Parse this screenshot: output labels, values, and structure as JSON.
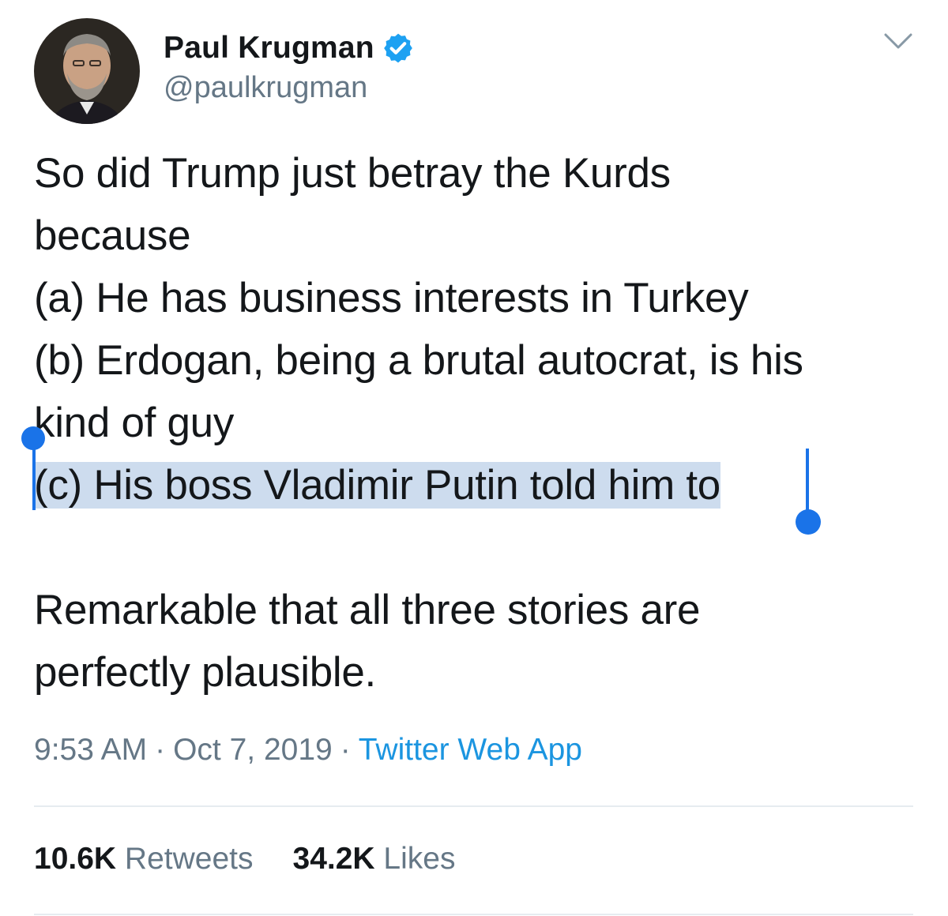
{
  "tweet": {
    "author": {
      "display_name": "Paul Krugman",
      "handle": "@paulkrugman",
      "verified_icon": "verified-badge-icon",
      "avatar_icon": "avatar"
    },
    "menu_icon": "chevron-down-icon",
    "text_lines": [
      "So did Trump just betray the Kurds",
      "because",
      "(a) He has business interests in Turkey",
      "(b) Erdogan, being a brutal autocrat, is his",
      "kind of guy",
      "(c) His boss Vladimir Putin told him to",
      "",
      "Remarkable that all three stories are",
      "perfectly plausible."
    ],
    "selected_line_index": 5,
    "meta": {
      "time": "9:53 AM",
      "separator": "·",
      "date": "Oct 7, 2019",
      "source": "Twitter Web App"
    },
    "stats": {
      "retweets_count": "10.6K",
      "retweets_label": "Retweets",
      "likes_count": "34.2K",
      "likes_label": "Likes"
    }
  },
  "colors": {
    "text": "#14171a",
    "muted": "#657786",
    "link": "#1b95e0",
    "verified": "#1da1f2",
    "selection": "#cddcee",
    "selection_handle": "#1a73e8"
  }
}
